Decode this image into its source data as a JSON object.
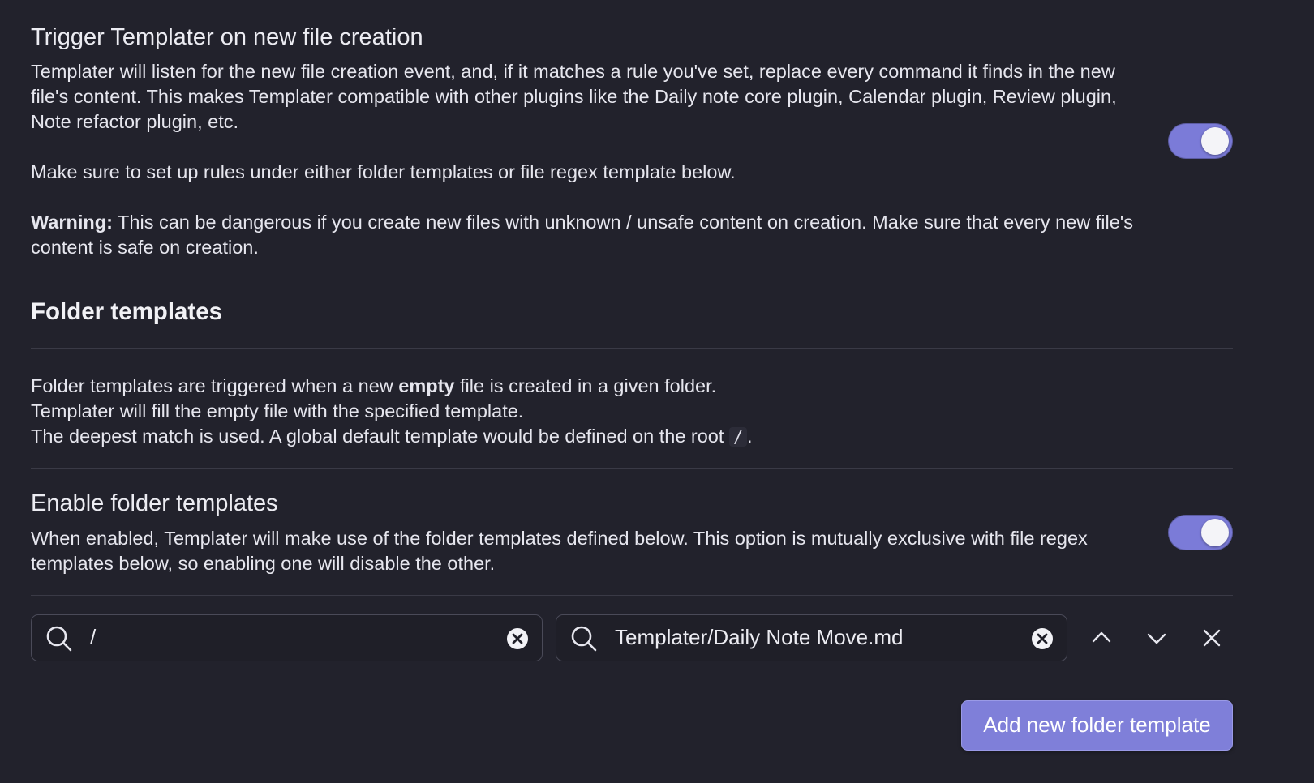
{
  "trigger_setting": {
    "name": "Trigger Templater on new file creation",
    "desc_1": "Templater will listen for the new file creation event, and, if it matches a rule you've set, replace every command it finds in the new file's content. This makes Templater compatible with other plugins like the Daily note core plugin, Calendar plugin, Review plugin, Note refactor plugin, etc.",
    "desc_2": "Make sure to set up rules under either folder templates or file regex template below.",
    "warning_label": "Warning:",
    "warning_text": " This can be dangerous if you create new files with unknown / unsafe content on creation. Make sure that every new file's content is safe on creation.",
    "enabled": true
  },
  "folder_templates": {
    "heading": "Folder templates",
    "desc_line1_before": "Folder templates are triggered when a new ",
    "desc_line1_bold": "empty",
    "desc_line1_after": " file is created in a given folder.",
    "desc_line2": "Templater will fill the empty file with the specified template.",
    "desc_line3_before": "The deepest match is used. A global default template would be defined on the root ",
    "desc_line3_code": "/",
    "desc_line3_after": "."
  },
  "enable_setting": {
    "name": "Enable folder templates",
    "desc": "When enabled, Templater will make use of the folder templates defined below. This option is mutually exclusive with file regex templates below, so enabling one will disable the other.",
    "enabled": true
  },
  "template_row": {
    "folder_value": "/",
    "template_value": "Templater/Daily Note Move.md",
    "icons": [
      "search-icon",
      "clear-icon",
      "chevron-up-icon",
      "chevron-down-icon",
      "close-icon"
    ]
  },
  "add_button_label": "Add new folder template",
  "colors": {
    "background": "#22222c",
    "accent": "#7f7fd9",
    "text": "#e8e8ef",
    "divider": "#3a3a46"
  }
}
